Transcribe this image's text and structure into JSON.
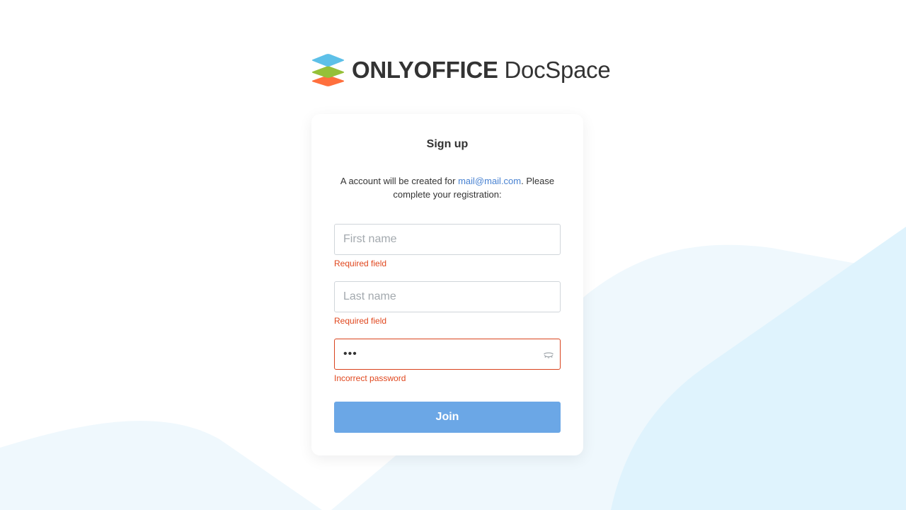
{
  "brand": {
    "name_bold": "ONLYOFFICE",
    "name_light": "DocSpace",
    "logo_colors": {
      "top": "#5dc0e8",
      "middle": "#95c038",
      "bottom": "#ff6f3d"
    }
  },
  "form": {
    "title": "Sign up",
    "description_prefix": "A account will be created for ",
    "email": "mail@mail.com",
    "description_suffix": ". Please complete your registration:",
    "first_name": {
      "placeholder": "First name",
      "value": "",
      "error": "Required field"
    },
    "last_name": {
      "placeholder": "Last name",
      "value": "",
      "error": "Required field"
    },
    "password": {
      "masked_value": "•••",
      "error": "Incorrect password",
      "icon": "eye-closed-icon"
    },
    "submit_label": "Join"
  },
  "colors": {
    "accent_button": "#6ba7e6",
    "link": "#4781d1",
    "error": "#e0471e",
    "background_shape": "#e6f5fd"
  }
}
